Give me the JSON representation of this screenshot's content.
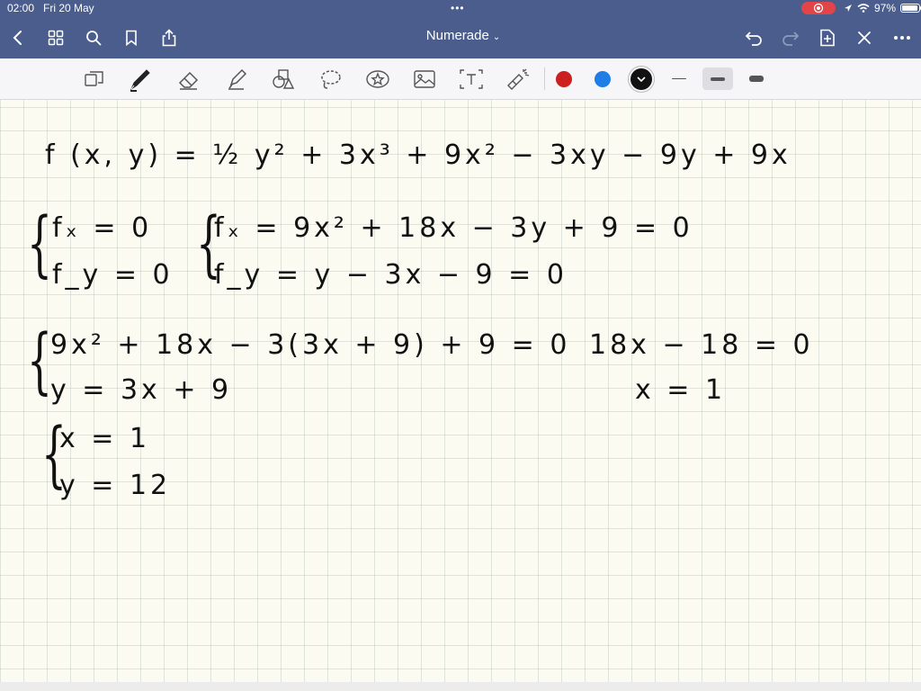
{
  "status_bar": {
    "time": "02:00",
    "date": "Fri 20 May",
    "battery": "97%",
    "battery_level": 0.97
  },
  "nav": {
    "title": "Numerade"
  },
  "toolbar": {
    "colors": [
      "#cc1f1f",
      "#1e7ee6",
      "#111111"
    ],
    "selected_color": "#111111",
    "tools": [
      "page-layout-icon",
      "pen-icon",
      "eraser-icon",
      "highlighter-icon",
      "shapes-icon",
      "lasso-icon",
      "sticker-icon",
      "image-icon",
      "text-icon",
      "laser-pointer-icon"
    ]
  },
  "notes": {
    "line1": "f (x, y) = ½ y² + 3x³ + 9x² − 3xy − 9y + 9x",
    "sys1_a": "fₓ = 0",
    "sys1_b": "f_y = 0",
    "sys2_a": "fₓ = 9x² + 18x − 3y + 9 = 0",
    "sys2_b": "f_y = y − 3x − 9 = 0",
    "sys3_a": "9x² + 18x − 3(3x + 9) + 9 = 0",
    "sys3_b": "y = 3x + 9",
    "side_a": "18x − 18 = 0",
    "side_b": "x = 1",
    "sys4_a": "x = 1",
    "sys4_b": "y = 12"
  }
}
